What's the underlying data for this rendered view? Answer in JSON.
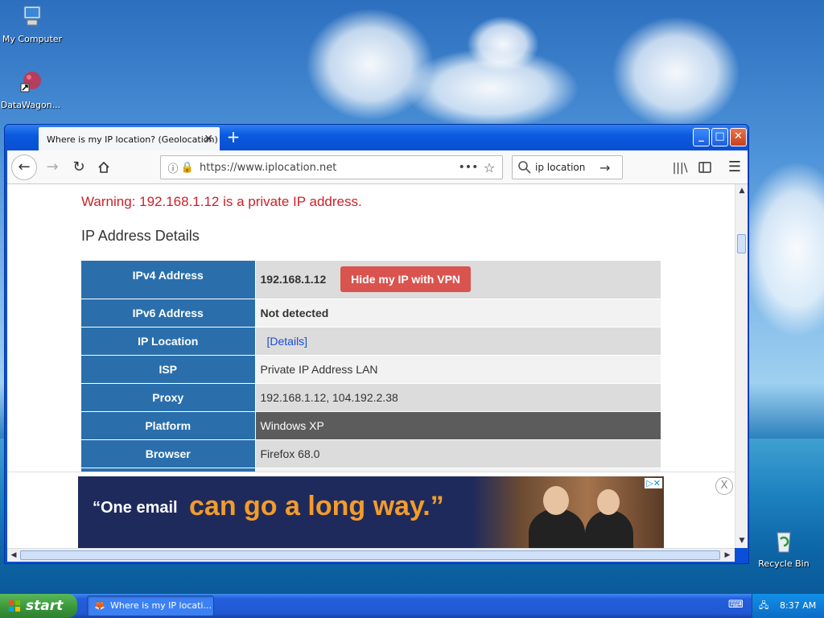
{
  "desktop": {
    "icons": [
      {
        "label": "My Computer"
      },
      {
        "label": "DataWagon..."
      },
      {
        "label": "Recycle Bin"
      }
    ]
  },
  "browser": {
    "tab_title": "Where is my IP location? (Geolocation)",
    "tab_close": "✕",
    "new_tab": "+",
    "url": "https://www.iplocation.net",
    "search_value": "ip location",
    "window_buttons": {
      "minimize": "_",
      "maximize": "□",
      "close": "✕"
    }
  },
  "page": {
    "warning": "Warning: 192.168.1.12 is a private IP address.",
    "section_title": "IP Address Details",
    "vpn_button": "Hide my IP with VPN",
    "rows": [
      {
        "key": "IPv4 Address",
        "value": "192.168.1.12"
      },
      {
        "key": "IPv6 Address",
        "value": "Not detected"
      },
      {
        "key": "IP Location",
        "value": "[Details]"
      },
      {
        "key": "ISP",
        "value": "Private IP Address LAN"
      },
      {
        "key": "Proxy",
        "value": "192.168.1.12, 104.192.2.38"
      },
      {
        "key": "Platform",
        "value": "Windows XP"
      },
      {
        "key": "Browser",
        "value": "Firefox 68.0"
      }
    ]
  },
  "ad": {
    "quote_part1": "“One email",
    "quote_part2": "can go a long way.”",
    "close_label": "X"
  },
  "taskbar": {
    "start_label": "start",
    "task_label": "Where is my IP locati...",
    "clock": "8:37 AM"
  }
}
